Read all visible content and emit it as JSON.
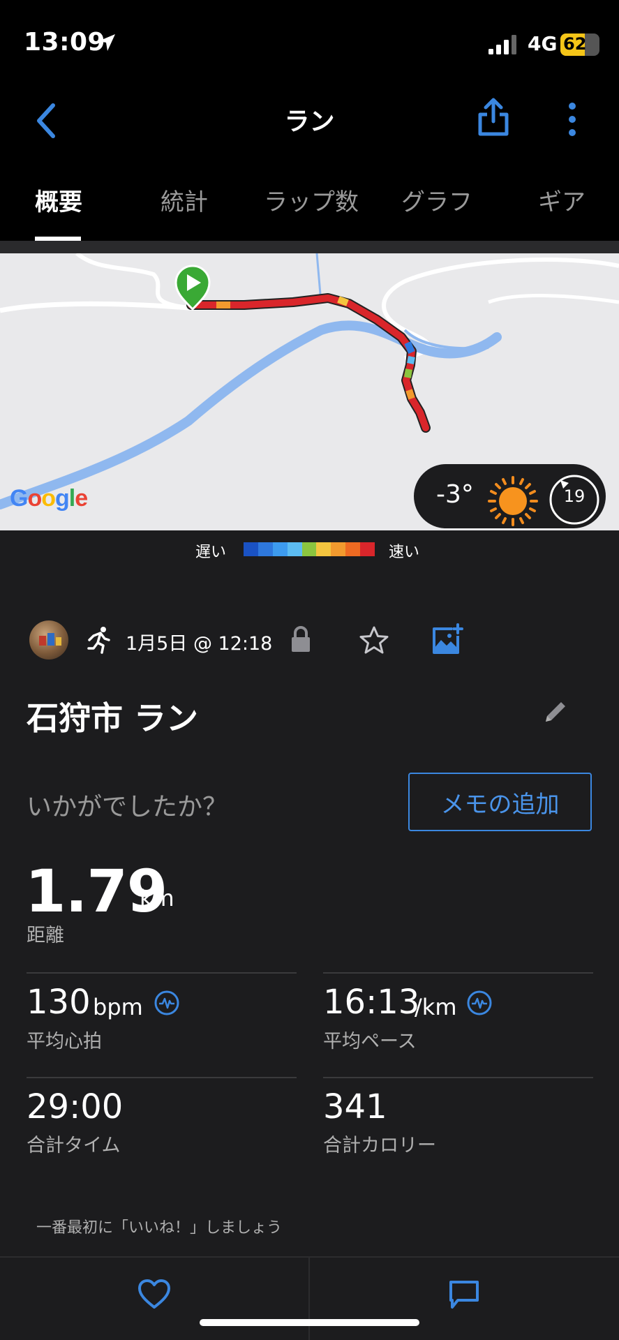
{
  "status_bar": {
    "time": "13:09",
    "network": "4G",
    "battery": "62",
    "battery_level": 0.62
  },
  "nav": {
    "title": "ラン"
  },
  "tabs": [
    {
      "label": "概要",
      "active": true
    },
    {
      "label": "統計",
      "active": false
    },
    {
      "label": "ラップ数",
      "active": false
    },
    {
      "label": "グラフ",
      "active": false
    },
    {
      "label": "ギア",
      "active": false
    }
  ],
  "map": {
    "provider_logo": "Google",
    "weather": {
      "temperature": "-3°",
      "condition_icon": "sun-icon",
      "wind": "19"
    },
    "legend": {
      "slow": "遅い",
      "fast": "速い",
      "colors": [
        "#1a52c4",
        "#2e78dd",
        "#3d9bef",
        "#5cbcf2",
        "#8bc53f",
        "#f4c53f",
        "#f29a2e",
        "#ee6a22",
        "#d9262b"
      ]
    }
  },
  "activity": {
    "date": "1月5日 @ 12:18",
    "title": "石狩市 ラン",
    "prompt": "いかがでしたか？",
    "memo_button": "メモの追加"
  },
  "stats": {
    "distance": {
      "value": "1.79",
      "unit": "km",
      "label": "距離"
    },
    "heart_rate": {
      "value": "130",
      "unit": "bpm",
      "label": "平均心拍"
    },
    "pace": {
      "value": "16:13",
      "unit": "/km",
      "label": "平均ペース"
    },
    "time": {
      "value": "29:00",
      "label": "合計タイム"
    },
    "calories": {
      "value": "341",
      "label": "合計カロリー"
    }
  },
  "social": {
    "like_prompt": "一番最初に「いいね！」しましょう"
  },
  "colors": {
    "accent": "#3b87e0",
    "background": "#1c1c1e"
  }
}
